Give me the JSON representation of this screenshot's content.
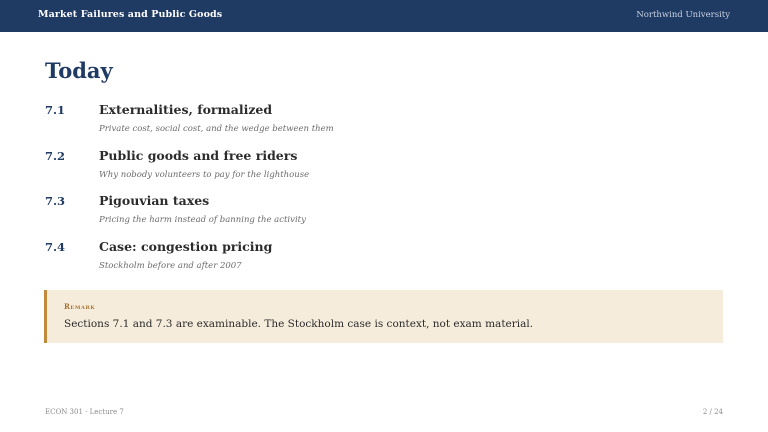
{
  "header": {
    "course_title": "Market Failures and Public Goods",
    "institution": "Northwind University"
  },
  "slide": {
    "title": "Today",
    "agenda": [
      {
        "number": "7.1",
        "heading": "Externalities, formalized",
        "subtitle": "Private cost, social cost, and the wedge between them"
      },
      {
        "number": "7.2",
        "heading": "Public goods and free riders",
        "subtitle": "Why nobody volunteers to pay for the lighthouse"
      },
      {
        "number": "7.3",
        "heading": "Pigouvian taxes",
        "subtitle": "Pricing the harm instead of banning the activity"
      },
      {
        "number": "7.4",
        "heading": "Case: congestion pricing",
        "subtitle": "Stockholm before and after 2007"
      }
    ],
    "remark": {
      "label": "Remark",
      "text": "Sections 7.1 and 7.3 are examinable. The Stockholm case is context, not exam material."
    }
  },
  "footer": {
    "lecture": "ECON 301 · Lecture 7",
    "page": "2 / 24"
  },
  "colors": {
    "header_bg": "#1f3a63",
    "accent": "#1f3a63",
    "remark_bg": "#f6ecdc",
    "remark_border": "#c08a3a"
  }
}
